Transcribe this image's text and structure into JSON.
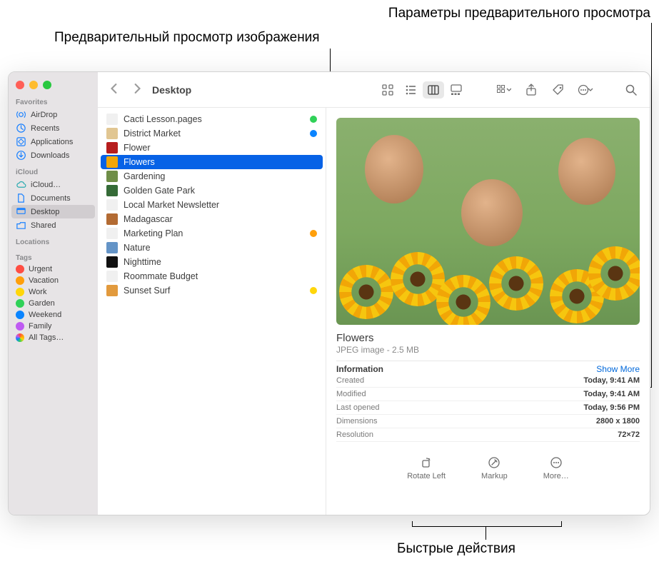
{
  "callouts": {
    "params": "Параметры предварительного просмотра",
    "preview": "Предварительный просмотр изображения",
    "quick": "Быстрые действия"
  },
  "toolbar": {
    "title": "Desktop"
  },
  "sidebar": {
    "favorites_heading": "Favorites",
    "icloud_heading": "iCloud",
    "locations_heading": "Locations",
    "tags_heading": "Tags",
    "favorites": [
      {
        "label": "AirDrop",
        "icon": "airdrop"
      },
      {
        "label": "Recents",
        "icon": "clock"
      },
      {
        "label": "Applications",
        "icon": "apps"
      },
      {
        "label": "Downloads",
        "icon": "download"
      }
    ],
    "icloud": [
      {
        "label": "iCloud…",
        "icon": "cloud"
      },
      {
        "label": "Documents",
        "icon": "doc"
      },
      {
        "label": "Desktop",
        "icon": "desktop",
        "selected": true
      },
      {
        "label": "Shared",
        "icon": "shared"
      }
    ],
    "tags": [
      {
        "label": "Urgent",
        "color": "#ff4d42"
      },
      {
        "label": "Vacation",
        "color": "#ff9f0a"
      },
      {
        "label": "Work",
        "color": "#ffd60a"
      },
      {
        "label": "Garden",
        "color": "#30d158"
      },
      {
        "label": "Weekend",
        "color": "#0a84ff"
      },
      {
        "label": "Family",
        "color": "#bf5af2"
      },
      {
        "label": "All Tags…",
        "color": ""
      }
    ]
  },
  "files": [
    {
      "name": "Cacti Lesson.pages",
      "fileicon": "#f0f0f0",
      "tag": "#30d158"
    },
    {
      "name": "District Market",
      "fileicon": "#e1c692",
      "tag": "#0a84ff"
    },
    {
      "name": "Flower",
      "fileicon": "#b71e1e",
      "tag": ""
    },
    {
      "name": "Flowers",
      "fileicon": "#f1a607",
      "tag": "",
      "selected": true
    },
    {
      "name": "Gardening",
      "fileicon": "#6f8e48",
      "tag": ""
    },
    {
      "name": "Golden Gate Park",
      "fileicon": "#356b37",
      "tag": ""
    },
    {
      "name": "Local Market Newsletter",
      "fileicon": "#f0f0f0",
      "tag": ""
    },
    {
      "name": "Madagascar",
      "fileicon": "#b36b33",
      "tag": ""
    },
    {
      "name": "Marketing Plan",
      "fileicon": "#f0f0f0",
      "tag": "#ff9f0a"
    },
    {
      "name": "Nature",
      "fileicon": "#6494c7",
      "tag": ""
    },
    {
      "name": "Nighttime",
      "fileicon": "#111111",
      "tag": ""
    },
    {
      "name": "Roommate Budget",
      "fileicon": "#f0f0f0",
      "tag": ""
    },
    {
      "name": "Sunset Surf",
      "fileicon": "#e29a3d",
      "tag": "#ffd60a"
    }
  ],
  "preview": {
    "title": "Flowers",
    "subtitle": "JPEG image - 2.5 MB",
    "info_label": "Information",
    "show_more": "Show More",
    "rows": [
      {
        "k": "Created",
        "v": "Today, 9:41 AM"
      },
      {
        "k": "Modified",
        "v": "Today, 9:41 AM"
      },
      {
        "k": "Last opened",
        "v": "Today, 9:56 PM"
      },
      {
        "k": "Dimensions",
        "v": "2800 x 1800"
      },
      {
        "k": "Resolution",
        "v": "72×72"
      }
    ],
    "actions": [
      {
        "label": "Rotate Left",
        "icon": "rotate"
      },
      {
        "label": "Markup",
        "icon": "markup"
      },
      {
        "label": "More…",
        "icon": "more"
      }
    ]
  }
}
